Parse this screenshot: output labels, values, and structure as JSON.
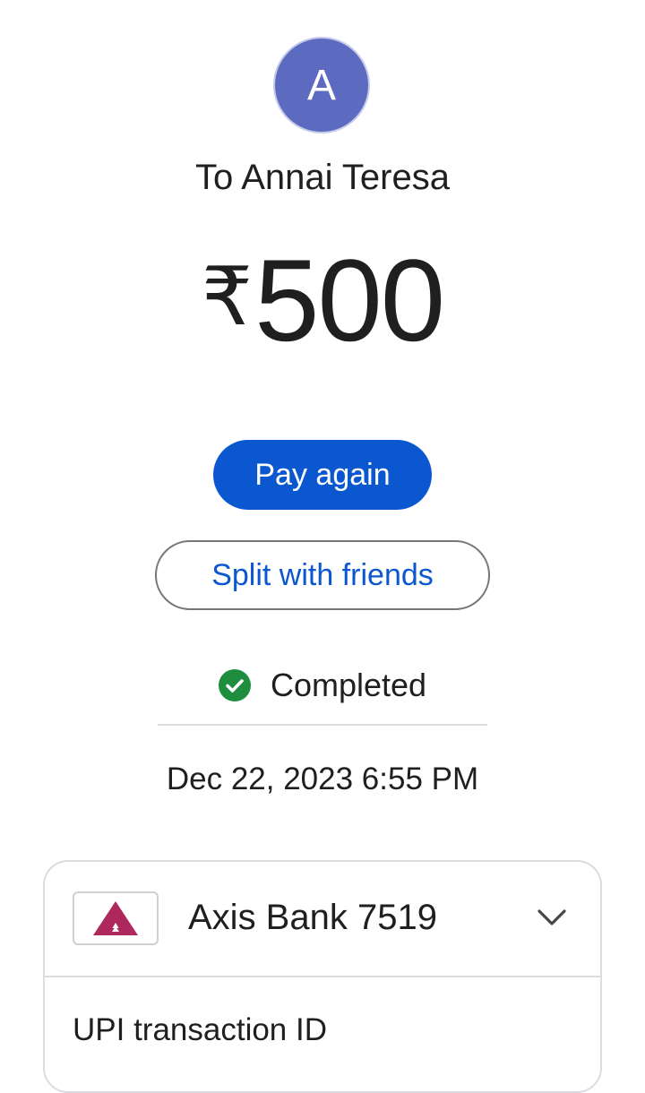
{
  "avatar": {
    "initial": "A",
    "color": "#5c6bc0"
  },
  "recipient": "To Annai Teresa",
  "amount": {
    "currency_symbol": "₹",
    "value": "500"
  },
  "actions": {
    "pay_again_label": "Pay again",
    "split_label": "Split with friends"
  },
  "status": {
    "icon": "check-circle-icon",
    "label": "Completed",
    "color": "#1e8e3e"
  },
  "datetime": "Dec 22, 2023 6:55 PM",
  "payment_source": {
    "bank_icon": "axis-bank-logo",
    "bank_name": "Axis Bank 7519",
    "expand_icon": "chevron-down-icon"
  },
  "details": {
    "upi_label": "UPI transaction ID"
  },
  "colors": {
    "accent": "#0b57d0",
    "brand_axis": "#ae285d"
  }
}
